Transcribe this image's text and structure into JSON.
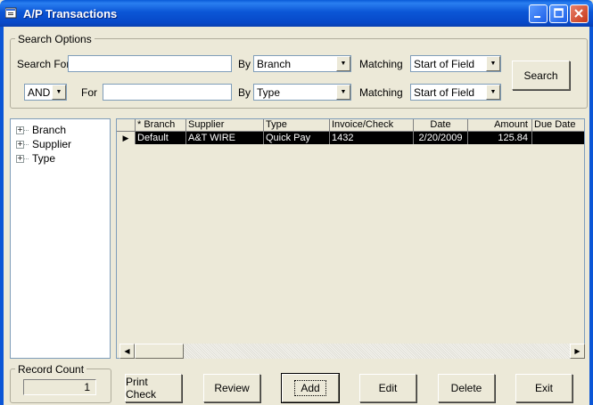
{
  "window": {
    "title": "A/P Transactions",
    "icon": "app-window-icon",
    "controls": [
      "minimize-icon",
      "maximize-icon",
      "close-icon"
    ]
  },
  "search_options": {
    "legend": "Search Options",
    "row1": {
      "search_for_label": "Search For",
      "search_for_value": "",
      "by_label": "By",
      "by_value": "Branch",
      "matching_label": "Matching",
      "matching_value": "Start of Field"
    },
    "row2": {
      "conjunction_value": "AND",
      "for_label": "For",
      "for_value": "",
      "by_label": "By",
      "by_value": "Type",
      "matching_label": "Matching",
      "matching_value": "Start of Field"
    },
    "search_button": "Search"
  },
  "tree": {
    "items": [
      {
        "label": "Branch"
      },
      {
        "label": "Supplier"
      },
      {
        "label": "Type"
      }
    ]
  },
  "grid": {
    "columns": [
      "* Branch",
      "Supplier",
      "Type",
      "Invoice/Check",
      "Date",
      "Amount",
      "Due Date"
    ],
    "rows": [
      {
        "branch": "Default",
        "supplier": "A&T WIRE",
        "type": "Quick Pay",
        "invoice_check": "1432",
        "date": "2/20/2009",
        "amount": "125.84",
        "due_date": ""
      }
    ]
  },
  "record_count": {
    "legend": "Record Count",
    "value": "1"
  },
  "buttons": {
    "print_check": "Print Check",
    "review": "Review",
    "add": "Add",
    "edit": "Edit",
    "delete": "Delete",
    "exit": "Exit"
  },
  "colors": {
    "titlebar": "#0b56d6",
    "window_bg": "#ece9d8",
    "selected_row_bg": "#000000",
    "selected_row_fg": "#ffffff"
  }
}
